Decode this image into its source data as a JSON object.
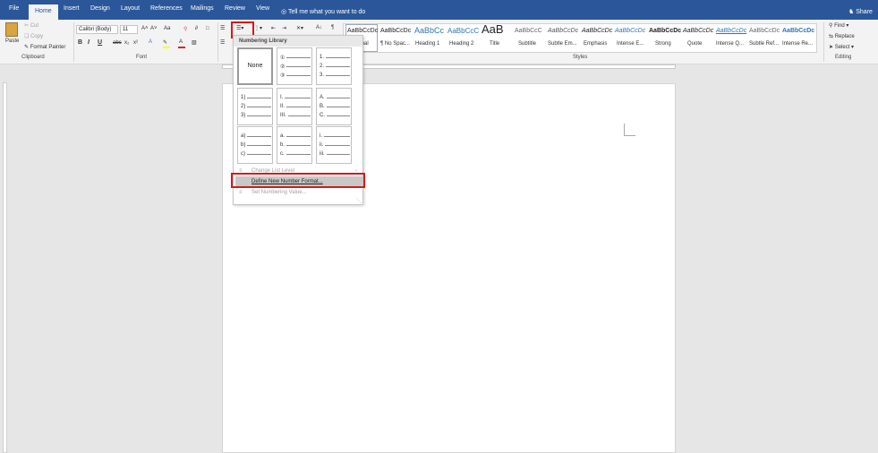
{
  "tabs": [
    "File",
    "Home",
    "Insert",
    "Design",
    "Layout",
    "References",
    "Mailings",
    "Review",
    "View"
  ],
  "active_tab": "Home",
  "tell_me": "Tell me what you want to do",
  "share": "Share",
  "clipboard": {
    "paste": "Paste",
    "cut": "Cut",
    "copy": "Copy",
    "format_painter": "Format Painter",
    "label": "Clipboard"
  },
  "font": {
    "name": "Calibri (Body)",
    "size": "11",
    "label": "Font",
    "grow": "A˄",
    "shrink": "A˅",
    "case": "Aa",
    "bold": "B",
    "italic": "I",
    "underline": "U",
    "strike": "abc",
    "sub": "x₂",
    "sup": "x²"
  },
  "paragraph": {
    "sort": "A↓",
    "pilcrow": "¶"
  },
  "styles": {
    "label": "Styles",
    "items": [
      {
        "sample": "AaBbCcDc",
        "name": "rmal"
      },
      {
        "sample": "AaBbCcDc",
        "name": "¶ No Spac..."
      },
      {
        "sample": "AaBbCc",
        "name": "Heading 1"
      },
      {
        "sample": "AaBbCcC",
        "name": "Heading 2"
      },
      {
        "sample": "AaB",
        "name": "Title"
      },
      {
        "sample": "AaBbCcC",
        "name": "Subtitle"
      },
      {
        "sample": "AaBbCcDc",
        "name": "Subtle Em..."
      },
      {
        "sample": "AaBbCcDc",
        "name": "Emphasis"
      },
      {
        "sample": "AaBbCcDc",
        "name": "Intense E..."
      },
      {
        "sample": "AaBbCcDc",
        "name": "Strong"
      },
      {
        "sample": "AaBbCcDc",
        "name": "Quote"
      },
      {
        "sample": "AaBbCcDc",
        "name": "Intense Q..."
      },
      {
        "sample": "AaBbCcDc",
        "name": "Subtle Ref..."
      },
      {
        "sample": "AaBbCcDc",
        "name": "Intense Re..."
      }
    ]
  },
  "editing": {
    "find": "Find",
    "replace": "Replace",
    "select": "Select",
    "label": "Editing"
  },
  "menu": {
    "header": "Numbering Library",
    "none": "None",
    "formats": [
      [
        "①",
        "②",
        "③"
      ],
      [
        "1.",
        "2.",
        "3."
      ],
      [
        "1)",
        "2)",
        "3)"
      ],
      [
        "I.",
        "II.",
        "III."
      ],
      [
        "A.",
        "B.",
        "C."
      ],
      [
        "a)",
        "b)",
        "c)"
      ],
      [
        "a.",
        "b.",
        "c."
      ],
      [
        "i.",
        "ii.",
        "iii."
      ]
    ],
    "change_level": "Change List Level",
    "define_new": "Define New Number Format...",
    "set_value": "Set Numbering Value..."
  },
  "colors": {
    "title_bar": "#2b579a",
    "highlight": "#d41b1b"
  }
}
